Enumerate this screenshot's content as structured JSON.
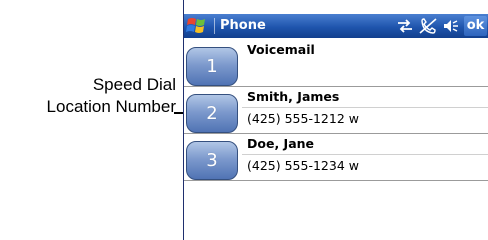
{
  "annotation": {
    "line1": "Speed Dial",
    "line2": "Location Number"
  },
  "titlebar": {
    "start_icon": "windows-flag-icon",
    "title": "Phone",
    "status_icons": [
      "connectivity-icon",
      "no-phone-signal-icon",
      "volume-icon"
    ],
    "ok_label": "ok"
  },
  "speed_dial": {
    "entries": [
      {
        "number": "1",
        "name": "Voicemail",
        "detail": ""
      },
      {
        "number": "2",
        "name": "Smith, James",
        "detail": "(425) 555-1212 w"
      },
      {
        "number": "3",
        "name": "Doe, Jane",
        "detail": "(425) 555-1234 w"
      }
    ]
  }
}
